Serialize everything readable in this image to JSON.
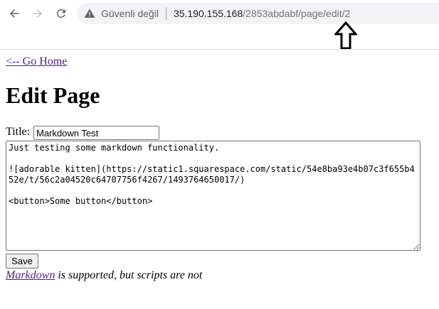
{
  "browser": {
    "security_label": "Güvenli değil",
    "url_host": "35.190.155.168",
    "url_path": "/2853abdabf/page/edit/2"
  },
  "page": {
    "go_home_link": "<-- Go Home",
    "heading": "Edit Page",
    "title_label": "Title:",
    "title_value": "Markdown Test",
    "content_value": "Just testing some markdown functionality.\n\n![adorable kitten](https://static1.squarespace.com/static/54e8ba93e4b07c3f655b452e/t/56c2a04520c64707756f4267/1493764650017/)\n\n<button>Some button</button>",
    "save_label": "Save",
    "note_link": "Markdown",
    "note_text": " is supported, but scripts are not"
  }
}
